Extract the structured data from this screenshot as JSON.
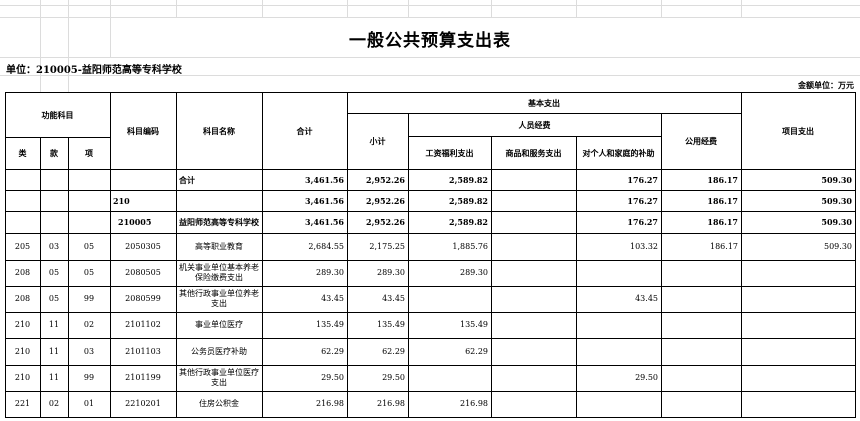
{
  "title": "一般公共预算支出表",
  "unit_label": "单位：210005-益阳师范高等专科学校",
  "amount_unit": "金额单位：万元",
  "headers": {
    "func_subject": "功能科目",
    "lei": "类",
    "kuan": "款",
    "xiang": "项",
    "code": "科目编码",
    "name": "科目名称",
    "total": "合计",
    "basic": "基本支出",
    "subtotal": "小计",
    "personnel": "人员经费",
    "wages": "工资福利支出",
    "goods": "商品和服务支出",
    "personal": "对个人和家庭的补助",
    "public": "公用经费",
    "project": "项目支出"
  },
  "rows": [
    {
      "lei": "",
      "kuan": "",
      "xiang": "",
      "code": "",
      "name": "合计",
      "total": "3,461.56",
      "subtotal": "2,952.26",
      "wages": "2,589.82",
      "goods": "",
      "personal": "176.27",
      "public": "186.17",
      "project": "509.30"
    },
    {
      "lei": "",
      "kuan": "",
      "xiang": "",
      "code": "210",
      "name": "",
      "total": "3,461.56",
      "subtotal": "2,952.26",
      "wages": "2,589.82",
      "goods": "",
      "personal": "176.27",
      "public": "186.17",
      "project": "509.30"
    },
    {
      "lei": "",
      "kuan": "",
      "xiang": "",
      "code": "210005",
      "name": "益阳师范高等专科学校",
      "total": "3,461.56",
      "subtotal": "2,952.26",
      "wages": "2,589.82",
      "goods": "",
      "personal": "176.27",
      "public": "186.17",
      "project": "509.30"
    },
    {
      "lei": "205",
      "kuan": "03",
      "xiang": "05",
      "code": "2050305",
      "name": "高等职业教育",
      "total": "2,684.55",
      "subtotal": "2,175.25",
      "wages": "1,885.76",
      "goods": "",
      "personal": "103.32",
      "public": "186.17",
      "project": "509.30"
    },
    {
      "lei": "208",
      "kuan": "05",
      "xiang": "05",
      "code": "2080505",
      "name": "机关事业单位基本养老保险缴费支出",
      "total": "289.30",
      "subtotal": "289.30",
      "wages": "289.30",
      "goods": "",
      "personal": "",
      "public": "",
      "project": ""
    },
    {
      "lei": "208",
      "kuan": "05",
      "xiang": "99",
      "code": "2080599",
      "name": "其他行政事业单位养老支出",
      "total": "43.45",
      "subtotal": "43.45",
      "wages": "",
      "goods": "",
      "personal": "43.45",
      "public": "",
      "project": ""
    },
    {
      "lei": "210",
      "kuan": "11",
      "xiang": "02",
      "code": "2101102",
      "name": "事业单位医疗",
      "total": "135.49",
      "subtotal": "135.49",
      "wages": "135.49",
      "goods": "",
      "personal": "",
      "public": "",
      "project": ""
    },
    {
      "lei": "210",
      "kuan": "11",
      "xiang": "03",
      "code": "2101103",
      "name": "公务员医疗补助",
      "total": "62.29",
      "subtotal": "62.29",
      "wages": "62.29",
      "goods": "",
      "personal": "",
      "public": "",
      "project": ""
    },
    {
      "lei": "210",
      "kuan": "11",
      "xiang": "99",
      "code": "2101199",
      "name": "其他行政事业单位医疗支出",
      "total": "29.50",
      "subtotal": "29.50",
      "wages": "",
      "goods": "",
      "personal": "29.50",
      "public": "",
      "project": ""
    },
    {
      "lei": "221",
      "kuan": "02",
      "xiang": "01",
      "code": "2210201",
      "name": "住房公积金",
      "total": "216.98",
      "subtotal": "216.98",
      "wages": "216.98",
      "goods": "",
      "personal": "",
      "public": "",
      "project": ""
    }
  ]
}
